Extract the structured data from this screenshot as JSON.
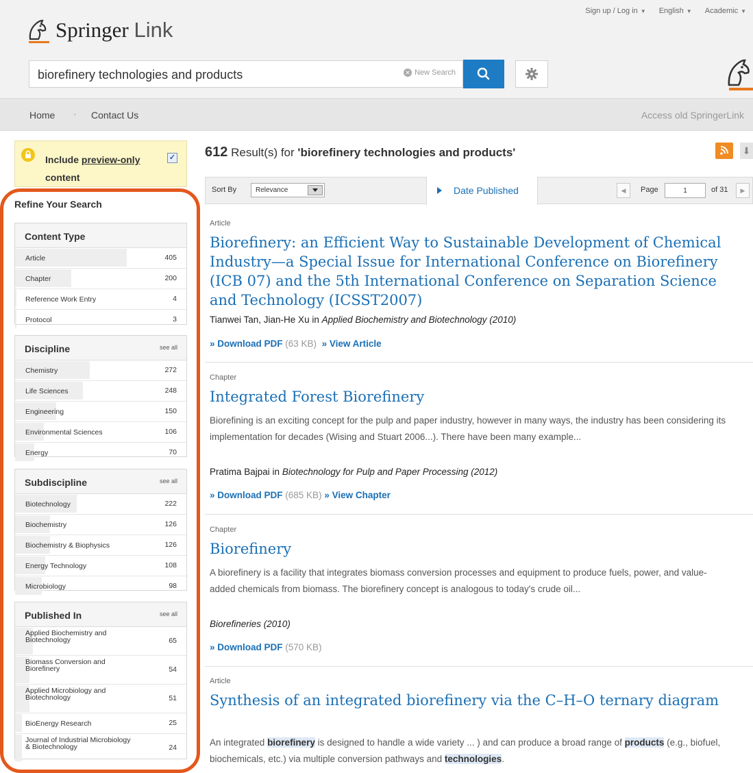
{
  "header": {
    "brand": "Springer",
    "brand_suffix": "Link",
    "top_links": [
      "Sign up / Log in",
      "English",
      "Academic"
    ],
    "search_value": "biorefinery technologies and products",
    "new_search": "New Search"
  },
  "nav": {
    "home": "Home",
    "separator": "·",
    "contact": "Contact Us",
    "old": "Access old SpringerLink"
  },
  "preview": {
    "line1_prefix": "Include ",
    "line1_link": "preview-only",
    "line2": "content",
    "checked": true
  },
  "refine_title": "Refine Your Search",
  "see_all": "see all",
  "facets": {
    "content_type": {
      "title": "Content Type",
      "items": [
        {
          "label": "Article",
          "count": "405",
          "share": 1.0
        },
        {
          "label": "Chapter",
          "count": "200",
          "share": 0.5
        },
        {
          "label": "Reference Work Entry",
          "count": "4",
          "share": 0.01
        },
        {
          "label": "Protocol",
          "count": "3",
          "share": 0.01
        }
      ]
    },
    "discipline": {
      "title": "Discipline",
      "items": [
        {
          "label": "Chemistry",
          "count": "272",
          "share": 0.67
        },
        {
          "label": "Life Sciences",
          "count": "248",
          "share": 0.61
        },
        {
          "label": "Engineering",
          "count": "150",
          "share": 0.37
        },
        {
          "label": "Environmental Sciences",
          "count": "106",
          "share": 0.26
        },
        {
          "label": "Energy",
          "count": "70",
          "share": 0.17
        }
      ]
    },
    "subdiscipline": {
      "title": "Subdiscipline",
      "items": [
        {
          "label": "Biotechnology",
          "count": "222",
          "share": 0.55
        },
        {
          "label": "Biochemistry",
          "count": "126",
          "share": 0.31
        },
        {
          "label": "Biochemistry & Biophysics",
          "count": "126",
          "share": 0.31
        },
        {
          "label": "Energy Technology",
          "count": "108",
          "share": 0.27
        },
        {
          "label": "Microbiology",
          "count": "98",
          "share": 0.24
        }
      ]
    },
    "published_in": {
      "title": "Published In",
      "items": [
        {
          "label": "Applied Biochemistry and Biotechnology",
          "count": "65",
          "share": 0.16
        },
        {
          "label": "Biomass Conversion and Biorefinery",
          "count": "54",
          "share": 0.13
        },
        {
          "label": "Applied Microbiology and Biotechnology",
          "count": "51",
          "share": 0.13
        },
        {
          "label": "BioEnergy Research",
          "count": "25",
          "share": 0.06
        },
        {
          "label": "Journal of Industrial Microbiology & Biotechnology",
          "count": "24",
          "share": 0.06
        }
      ]
    }
  },
  "results_header": {
    "count": "612",
    "text": " Result(s) for ",
    "query": "'biorefinery technologies and products'"
  },
  "sortbar": {
    "sort_by": "Sort By",
    "selected": "Relevance",
    "date_published": "Date Published",
    "page_label": "Page",
    "page_value": "1",
    "of_label": "of 31"
  },
  "results": [
    {
      "type": "Article",
      "title": "Biorefinery: an Efficient Way to Sustainable Development of Chemical Industry—a Special Issue for International Conference on Biorefinery (ICB 07) and the 5th International Conference on Separation Science and Technology (ICSST2007)",
      "authors": "Tianwei Tan, Jian-He Xu in ",
      "source": "Applied Biochemistry and Biotechnology (2010)",
      "download": "» Download PDF",
      "size": " (63 KB)",
      "view": "» View Article"
    },
    {
      "type": "Chapter",
      "title": "Integrated Forest Biorefinery",
      "snippet": "Biorefining is an exciting concept for the pulp and paper industry, however in many ways, the industry has been considering its implementation for decades (Wising and Stuart 2006...). There have been many example...",
      "authors": "Pratima Bajpai in ",
      "source": "Biotechnology for Pulp and Paper Processing (2012)",
      "download": "» Download PDF",
      "size": " (685 KB)",
      "view": "» View Chapter"
    },
    {
      "type": "Chapter",
      "title": "Biorefinery",
      "snippet": "A biorefinery is a facility that integrates biomass conversion processes and equipment to produce fuels, power, and value-added chemicals from biomass. The biorefinery concept is analogous to today's crude oil...",
      "source": "Biorefineries (2010)",
      "download": "» Download PDF",
      "size": " (570 KB)"
    },
    {
      "type": "Article",
      "title": "Synthesis of an integrated biorefinery via the C–H–O ternary diagram",
      "snippet_parts": [
        "An integrated ",
        "biorefinery",
        " is designed to handle a wide variety ... ) and can produce a broad range of ",
        "products",
        " (e.g., biofuel, biochemicals, etc.) via multiple conversion pathways and ",
        "technologies",
        "."
      ]
    }
  ],
  "colors": {
    "accent": "#1a6fb5",
    "highlight_ring": "#e3581c",
    "rss": "#f08c23",
    "brand_orange": "#e8781b"
  }
}
